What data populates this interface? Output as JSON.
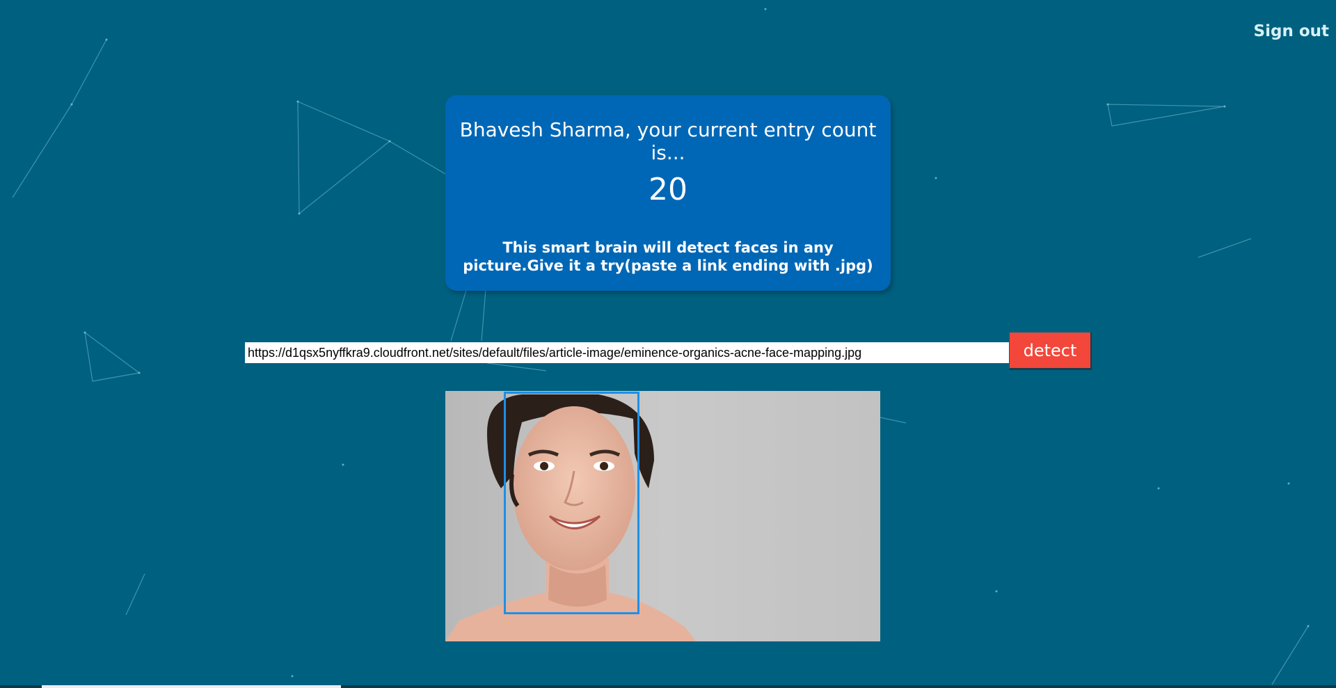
{
  "header": {
    "signout_label": "Sign out"
  },
  "rank": {
    "title": "Bhavesh Sharma, your current entry count is...",
    "count": "20",
    "description": "This smart brain will detect faces in any picture.Give it a try(paste a link ending with .jpg)"
  },
  "form": {
    "url_value": "https://d1qsx5nyffkra9.cloudfront.net/sites/default/files/article-image/eminence-organics-acne-face-mapping.jpg",
    "detect_label": "detect"
  },
  "colors": {
    "background": "#00607f",
    "card": "#0067b6",
    "detect_button": "#f2473a",
    "face_box": "#1e8fe6"
  },
  "icons": {
    "detected_face": "face-bounding-box"
  }
}
